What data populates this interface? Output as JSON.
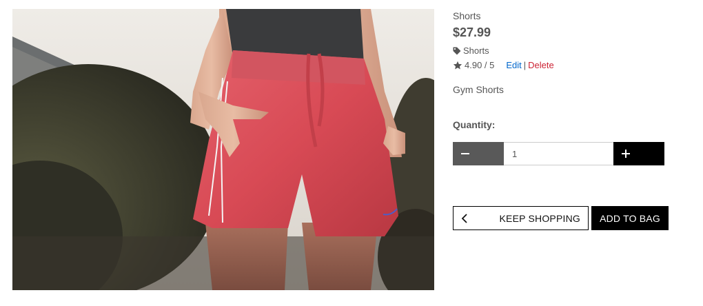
{
  "product": {
    "category": "Shorts",
    "price": "$27.99",
    "tag_label": "Shorts",
    "rating": "4.90 / 5",
    "edit_label": "Edit",
    "separator": "|",
    "delete_label": "Delete",
    "description": "Gym Shorts",
    "image_subject": "red gym shorts"
  },
  "quantity": {
    "label": "Quantity:",
    "value": "1"
  },
  "actions": {
    "keep_shopping_label": "KEEP SHOPPING",
    "add_to_bag_label": "ADD TO BAG"
  },
  "icons": {
    "tag": "tag-icon",
    "star": "star-icon",
    "minus": "minus-icon",
    "plus": "plus-icon",
    "back": "chevron-left-icon"
  },
  "colors": {
    "edit_link": "#0066cc",
    "delete_link": "#cc2233",
    "minus_button": "#595959",
    "plus_button": "#000000",
    "add_to_bag_button": "#000000"
  }
}
